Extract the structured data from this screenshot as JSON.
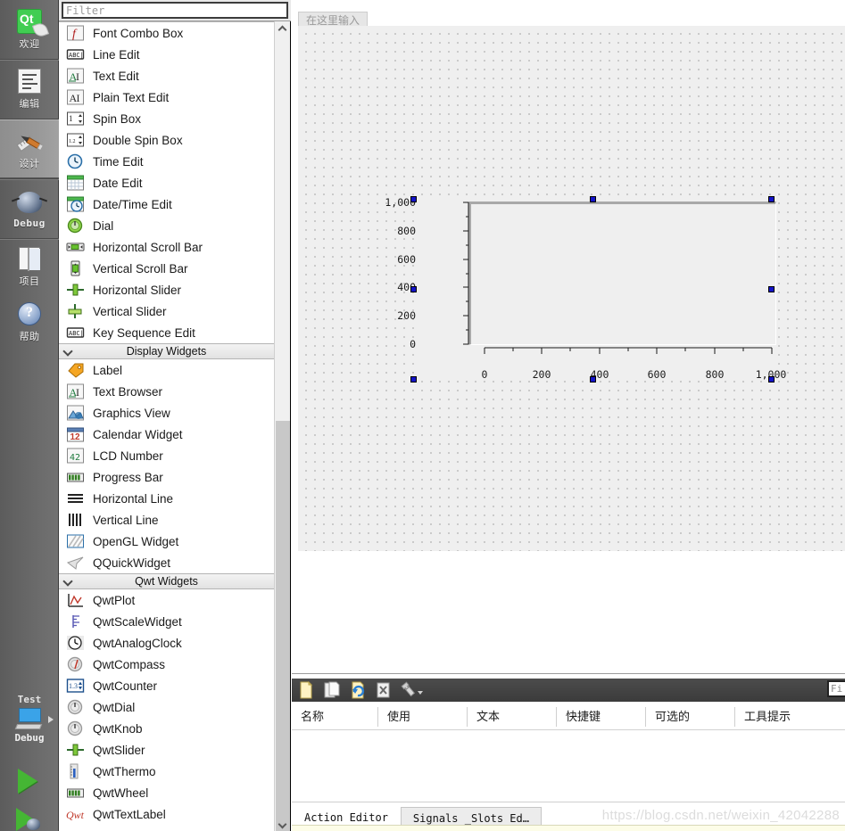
{
  "modebar": {
    "items": [
      {
        "label": "欢迎",
        "icon": "qt-logo-icon",
        "active": false
      },
      {
        "label": "编辑",
        "icon": "document-edit-icon",
        "active": false
      },
      {
        "label": "设计",
        "icon": "design-brush-ruler-icon",
        "active": true
      },
      {
        "label": "Debug",
        "icon": "debug-bug-icon",
        "active": false
      },
      {
        "label": "项目",
        "icon": "project-folder-icon",
        "active": false
      },
      {
        "label": "帮助",
        "icon": "help-question-icon",
        "active": false
      }
    ],
    "kit": {
      "project_label": "Test",
      "build_label": "Debug",
      "icon": "computer-monitor-icon"
    },
    "run_icon": "run-play-icon",
    "debug_icon": "run-debug-icon"
  },
  "widgetbox": {
    "filter": {
      "value": "",
      "placeholder": "Filter"
    },
    "scroll": {
      "up_icon": "chevron-up-icon",
      "down_icon": "chevron-down-icon"
    },
    "groups": [
      {
        "type": "items",
        "items": [
          {
            "label": "Font Combo Box",
            "icon": "font-combo-box-icon"
          },
          {
            "label": "Line Edit",
            "icon": "line-edit-icon"
          },
          {
            "label": "Text Edit",
            "icon": "text-edit-icon"
          },
          {
            "label": "Plain Text Edit",
            "icon": "plain-text-edit-icon"
          },
          {
            "label": "Spin Box",
            "icon": "spin-box-icon"
          },
          {
            "label": "Double Spin Box",
            "icon": "double-spin-box-icon"
          },
          {
            "label": "Time Edit",
            "icon": "time-edit-icon"
          },
          {
            "label": "Date Edit",
            "icon": "date-edit-icon"
          },
          {
            "label": "Date/Time Edit",
            "icon": "date-time-edit-icon"
          },
          {
            "label": "Dial",
            "icon": "dial-icon"
          },
          {
            "label": "Horizontal Scroll Bar",
            "icon": "horizontal-scroll-bar-icon"
          },
          {
            "label": "Vertical Scroll Bar",
            "icon": "vertical-scroll-bar-icon"
          },
          {
            "label": "Horizontal Slider",
            "icon": "horizontal-slider-icon"
          },
          {
            "label": "Vertical Slider",
            "icon": "vertical-slider-icon"
          },
          {
            "label": "Key Sequence Edit",
            "icon": "key-sequence-edit-icon"
          }
        ]
      },
      {
        "type": "header",
        "label": "Display Widgets",
        "expanded": true
      },
      {
        "type": "items",
        "items": [
          {
            "label": "Label",
            "icon": "label-icon"
          },
          {
            "label": "Text Browser",
            "icon": "text-browser-icon"
          },
          {
            "label": "Graphics View",
            "icon": "graphics-view-icon"
          },
          {
            "label": "Calendar Widget",
            "icon": "calendar-widget-icon"
          },
          {
            "label": "LCD Number",
            "icon": "lcd-number-icon"
          },
          {
            "label": "Progress Bar",
            "icon": "progress-bar-icon"
          },
          {
            "label": "Horizontal Line",
            "icon": "horizontal-line-icon"
          },
          {
            "label": "Vertical Line",
            "icon": "vertical-line-icon"
          },
          {
            "label": "OpenGL Widget",
            "icon": "opengl-widget-icon"
          },
          {
            "label": "QQuickWidget",
            "icon": "qquickwidget-icon"
          }
        ]
      },
      {
        "type": "header",
        "label": "Qwt Widgets",
        "expanded": true
      },
      {
        "type": "items",
        "items": [
          {
            "label": "QwtPlot",
            "icon": "qwtplot-icon"
          },
          {
            "label": "QwtScaleWidget",
            "icon": "qwtscalewidget-icon"
          },
          {
            "label": "QwtAnalogClock",
            "icon": "qwtanalogclock-icon"
          },
          {
            "label": "QwtCompass",
            "icon": "qwtcompass-icon"
          },
          {
            "label": "QwtCounter",
            "icon": "qwtcounter-icon"
          },
          {
            "label": "QwtDial",
            "icon": "qwtdial-icon"
          },
          {
            "label": "QwtKnob",
            "icon": "qwtknob-icon"
          },
          {
            "label": "QwtSlider",
            "icon": "qwtslider-icon"
          },
          {
            "label": "QwtThermo",
            "icon": "qwtthermo-icon"
          },
          {
            "label": "QwtWheel",
            "icon": "qwtwheel-icon"
          },
          {
            "label": "QwtTextLabel",
            "icon": "qwttextlabel-icon"
          }
        ]
      }
    ]
  },
  "form": {
    "menubar_placeholder": "在这里输入",
    "selected_widget": "QwtPlot"
  },
  "chart_data": {
    "type": "line",
    "title": "",
    "xlabel": "",
    "ylabel": "",
    "x_ticks": [
      "0",
      "200",
      "400",
      "600",
      "800",
      "1,000"
    ],
    "y_ticks": [
      "0",
      "200",
      "400",
      "600",
      "800",
      "1,000"
    ],
    "xlim": [
      0,
      1000
    ],
    "ylim": [
      0,
      1000
    ],
    "grid": false,
    "series": [],
    "legend": null
  },
  "action_editor": {
    "toolbar": [
      {
        "name": "new-action-button",
        "icon": "new-document-icon"
      },
      {
        "name": "copy-action-button",
        "icon": "copy-document-icon"
      },
      {
        "name": "edit-action-button",
        "icon": "edit-refresh-icon"
      },
      {
        "name": "delete-action-button",
        "icon": "delete-x-icon"
      },
      {
        "name": "configure-button",
        "icon": "wrench-icon"
      }
    ],
    "filter": {
      "value": "",
      "placeholder": "Fi"
    },
    "columns": [
      "名称",
      "使用",
      "文本",
      "快捷键",
      "可选的",
      "工具提示"
    ],
    "rows": [],
    "tabs": [
      {
        "label": "Action Editor",
        "active": true
      },
      {
        "label": "Signals _Slots Ed…",
        "active": false
      }
    ]
  },
  "watermark": "https://blog.csdn.net/weixin_42042288"
}
